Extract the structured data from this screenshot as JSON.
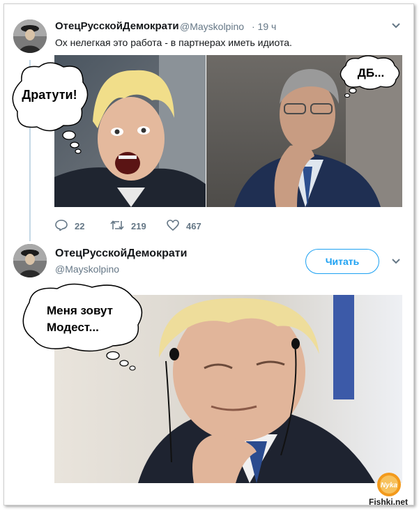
{
  "tweet1": {
    "author_name": "ОтецРусскойДемократи",
    "handle": "@Mayskolpino",
    "time": "· 19 ч",
    "text": "Ох нелегкая это работа - в партнерах иметь идиота.",
    "replies": "22",
    "retweets": "219",
    "likes": "467",
    "bubble_left": "Дратути!",
    "bubble_right": "ДБ..."
  },
  "tweet2": {
    "author_name": "ОтецРусскойДемократи",
    "handle": "@Mayskolpino",
    "follow_label": "Читать",
    "bubble_line1": "Меня зовут",
    "bubble_line2": "Модест..."
  },
  "watermark": {
    "badge": "Nyka",
    "site": "Fishki.net"
  },
  "icons": [
    "avatar",
    "reply-icon",
    "retweet-icon",
    "like-icon",
    "chevron-down-icon"
  ],
  "colors": {
    "accent": "#1da1f2",
    "muted": "#657786",
    "thread_line": "#c4d8e6"
  }
}
